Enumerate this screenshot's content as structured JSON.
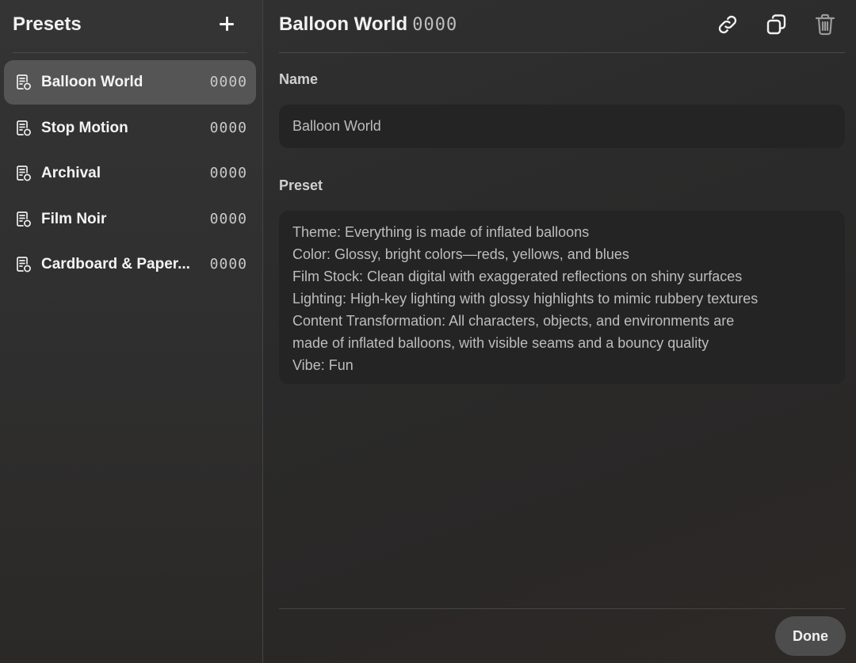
{
  "sidebar": {
    "title": "Presets",
    "add_icon": "plus-icon",
    "items": [
      {
        "label": "Balloon World",
        "code": "0000",
        "icon": "preset-doc-icon",
        "active": true
      },
      {
        "label": "Stop Motion",
        "code": "0000",
        "icon": "preset-doc-icon",
        "active": false
      },
      {
        "label": "Archival",
        "code": "0000",
        "icon": "preset-doc-icon",
        "active": false
      },
      {
        "label": "Film Noir",
        "code": "0000",
        "icon": "preset-doc-icon",
        "active": false
      },
      {
        "label": "Cardboard & Paper...",
        "code": "0000",
        "icon": "preset-doc-icon",
        "active": false
      }
    ]
  },
  "main": {
    "title": "Balloon World",
    "code": "0000",
    "icons": [
      "link-icon",
      "copy-icon",
      "trash-icon"
    ],
    "name_label": "Name",
    "name_value": "Balloon World",
    "preset_label": "Preset",
    "preset_text": "Theme: Everything is made of inflated balloons\nColor: Glossy, bright colors—reds, yellows, and blues\nFilm Stock: Clean digital with exaggerated reflections on shiny surfaces\nLighting: High-key lighting with glossy highlights to mimic rubbery textures\nContent Transformation: All characters, objects, and environments are\nmade of inflated balloons, with visible seams and a bouncy quality\nVibe: Fun",
    "done_label": "Done"
  },
  "colors": {
    "background": "#2b2b2b",
    "active_item": "#555555",
    "field_bg": "#242424",
    "done_button": "#4d4d4d"
  }
}
